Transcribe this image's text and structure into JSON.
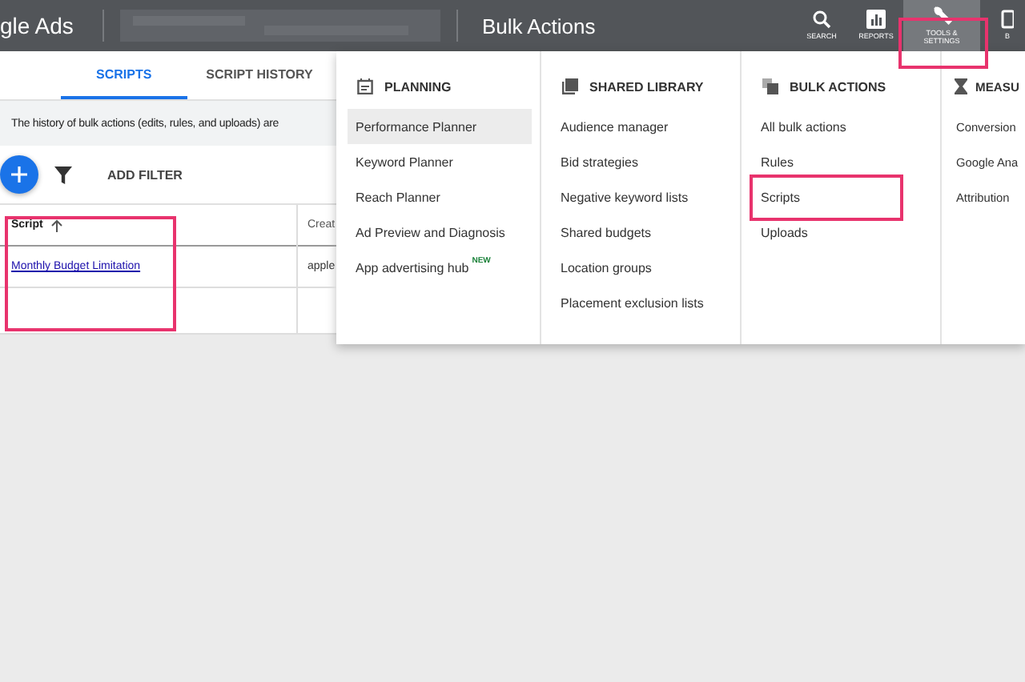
{
  "header": {
    "product": "gle Ads",
    "page_title": "Bulk Actions",
    "nav": [
      {
        "kind": "search",
        "label": "SEARCH",
        "selected": false,
        "highlighted": false
      },
      {
        "kind": "reports",
        "label": "REPORTS",
        "selected": false,
        "highlighted": false
      },
      {
        "kind": "tools",
        "label": "TOOLS & SETTINGS",
        "selected": true,
        "highlighted": true
      },
      {
        "kind": "billing",
        "label": "B",
        "selected": false,
        "highlighted": false
      }
    ]
  },
  "tabs": [
    {
      "label": "SCRIPTS",
      "selected": true
    },
    {
      "label": "SCRIPT HISTORY",
      "selected": false
    }
  ],
  "info_bar": "The history of bulk actions (edits, rules, and uploads) are",
  "toolbar": {
    "filter_label": "ADD FILTER"
  },
  "table": {
    "columns": [
      {
        "label": "Script",
        "sorted": true,
        "highlighted": true
      },
      {
        "label": "Creat",
        "sorted": false,
        "highlighted": false
      }
    ],
    "rows": [
      {
        "cells": [
          "Monthly Budget Limitation",
          "apple"
        ]
      }
    ]
  },
  "menu": {
    "columns": [
      {
        "kind": "planning",
        "title": "PLANNING",
        "items": [
          {
            "label": "Performance Planner",
            "selected": true,
            "highlighted": false
          },
          {
            "label": "Keyword Planner",
            "selected": false,
            "highlighted": false
          },
          {
            "label": "Reach Planner",
            "selected": false,
            "highlighted": false
          },
          {
            "label": "Ad Preview and Diagnosis",
            "selected": false,
            "highlighted": false
          },
          {
            "label": "App advertising hub",
            "badge": "NEW",
            "selected": false,
            "highlighted": false
          }
        ]
      },
      {
        "kind": "library",
        "title": "SHARED LIBRARY",
        "items": [
          {
            "label": "Audience manager",
            "selected": false,
            "highlighted": false
          },
          {
            "label": "Bid strategies",
            "selected": false,
            "highlighted": false
          },
          {
            "label": "Negative keyword lists",
            "selected": false,
            "highlighted": false
          },
          {
            "label": "Shared budgets",
            "selected": false,
            "highlighted": false
          },
          {
            "label": "Location groups",
            "selected": false,
            "highlighted": false
          },
          {
            "label": "Placement exclusion lists",
            "selected": false,
            "highlighted": false
          }
        ]
      },
      {
        "kind": "bulk",
        "title": "BULK ACTIONS",
        "items": [
          {
            "label": "All bulk actions",
            "selected": false,
            "highlighted": false
          },
          {
            "label": "Rules",
            "selected": false,
            "highlighted": false
          },
          {
            "label": "Scripts",
            "selected": false,
            "highlighted": true
          },
          {
            "label": "Uploads",
            "selected": false,
            "highlighted": false
          }
        ]
      },
      {
        "kind": "measurement",
        "title": "MEASU",
        "items": [
          {
            "label": "Conversion",
            "selected": false,
            "highlighted": false
          },
          {
            "label": "Google Ana",
            "selected": false,
            "highlighted": false
          },
          {
            "label": "Attribution",
            "selected": false,
            "highlighted": false
          }
        ]
      }
    ]
  }
}
